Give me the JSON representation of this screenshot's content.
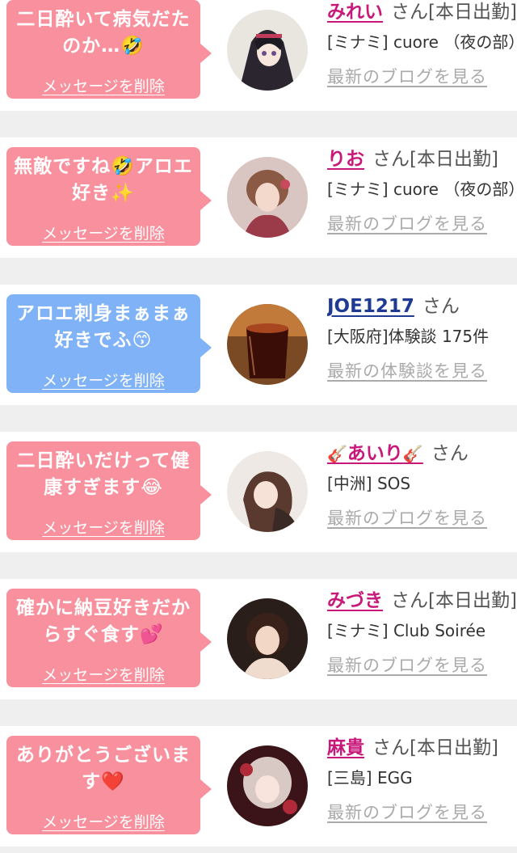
{
  "delete_label": "メッセージを削除",
  "colors": {
    "pink_bubble": "#f8919d",
    "blue_bubble": "#7fb2f6",
    "girl_name": "#c8197a",
    "user_name": "#1f3a93",
    "link_gray": "#aaaaaa"
  },
  "items": [
    {
      "message": "二日酔いて病気だたのか…🤣",
      "name": "みれい",
      "suffix": "さん[本日出勤]",
      "shop": "[ミナミ] cuore （夜の部）",
      "link": "最新のブログを見る",
      "type": "girl"
    },
    {
      "message": "無敵ですね🤣アロエ好き✨",
      "name": "りお",
      "suffix": "さん[本日出勤]",
      "shop": "[ミナミ] cuore （夜の部）",
      "link": "最新のブログを見る",
      "type": "girl"
    },
    {
      "message": "アロエ刺身まぁまぁ好きでふ😙",
      "name": "JOE1217",
      "suffix": "さん",
      "shop": "[大阪府]体験談 175件",
      "link": "最新の体験談を見る",
      "type": "user"
    },
    {
      "message": "二日酔いだけって健康すぎます😂",
      "name": "あいり",
      "name_prefix_icon": "🎸",
      "name_suffix_icon": "🎸",
      "suffix": "さん",
      "shop": "[中洲] SOS",
      "link": "最新のブログを見る",
      "type": "girl"
    },
    {
      "message": "確かに納豆好きだからすぐ食す💕",
      "name": "みづき",
      "suffix": "さん[本日出勤]",
      "shop": "[ミナミ] Club Soirée",
      "link": "最新のブログを見る",
      "type": "girl"
    },
    {
      "message": "ありがとうございます❤️",
      "name": "麻貴",
      "suffix": "さん[本日出勤]",
      "shop": "[三島] EGG",
      "link": "最新のブログを見る",
      "type": "girl"
    }
  ]
}
